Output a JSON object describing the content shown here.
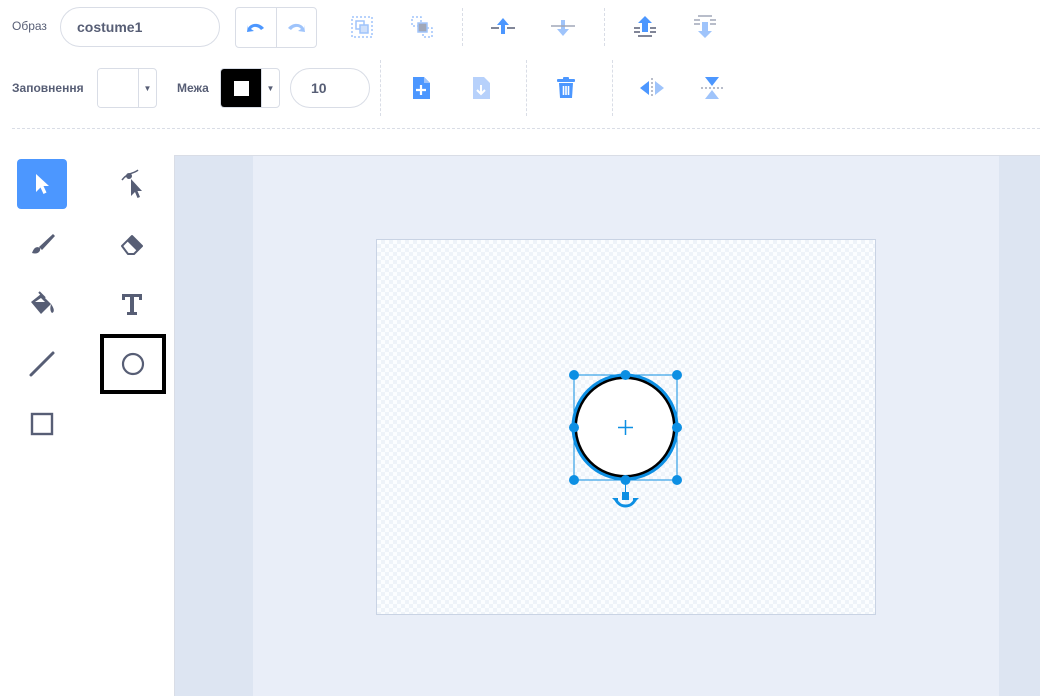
{
  "toolbar": {
    "costume_label": "Образ",
    "costume_name": "costume1",
    "fill_label": "Заповнення",
    "outline_label": "Межа",
    "outline_width": "10"
  },
  "colors": {
    "accent": "#4c97ff",
    "fill_swatch": "#ffffff",
    "outline_swatch": "#000000",
    "selection": "#0d8fe3",
    "text": "#575e75"
  },
  "icons": {
    "undo": "undo-icon",
    "redo": "redo-icon",
    "group": "group-icon",
    "ungroup": "ungroup-icon",
    "forward": "forward-icon",
    "backward": "backward-icon",
    "front": "front-icon",
    "back": "back-icon",
    "copy": "copy-icon",
    "paste": "paste-icon",
    "delete": "trash-icon",
    "flip_horizontal": "flip-horizontal-icon",
    "flip_vertical": "flip-vertical-icon"
  },
  "tools": [
    {
      "name": "select",
      "active": true
    },
    {
      "name": "reshape",
      "active": false
    },
    {
      "name": "brush",
      "active": false
    },
    {
      "name": "eraser",
      "active": false
    },
    {
      "name": "fill",
      "active": false
    },
    {
      "name": "text",
      "active": false
    },
    {
      "name": "line",
      "active": false
    },
    {
      "name": "circle",
      "active": false,
      "highlighted": true
    },
    {
      "name": "rectangle",
      "active": false
    }
  ]
}
